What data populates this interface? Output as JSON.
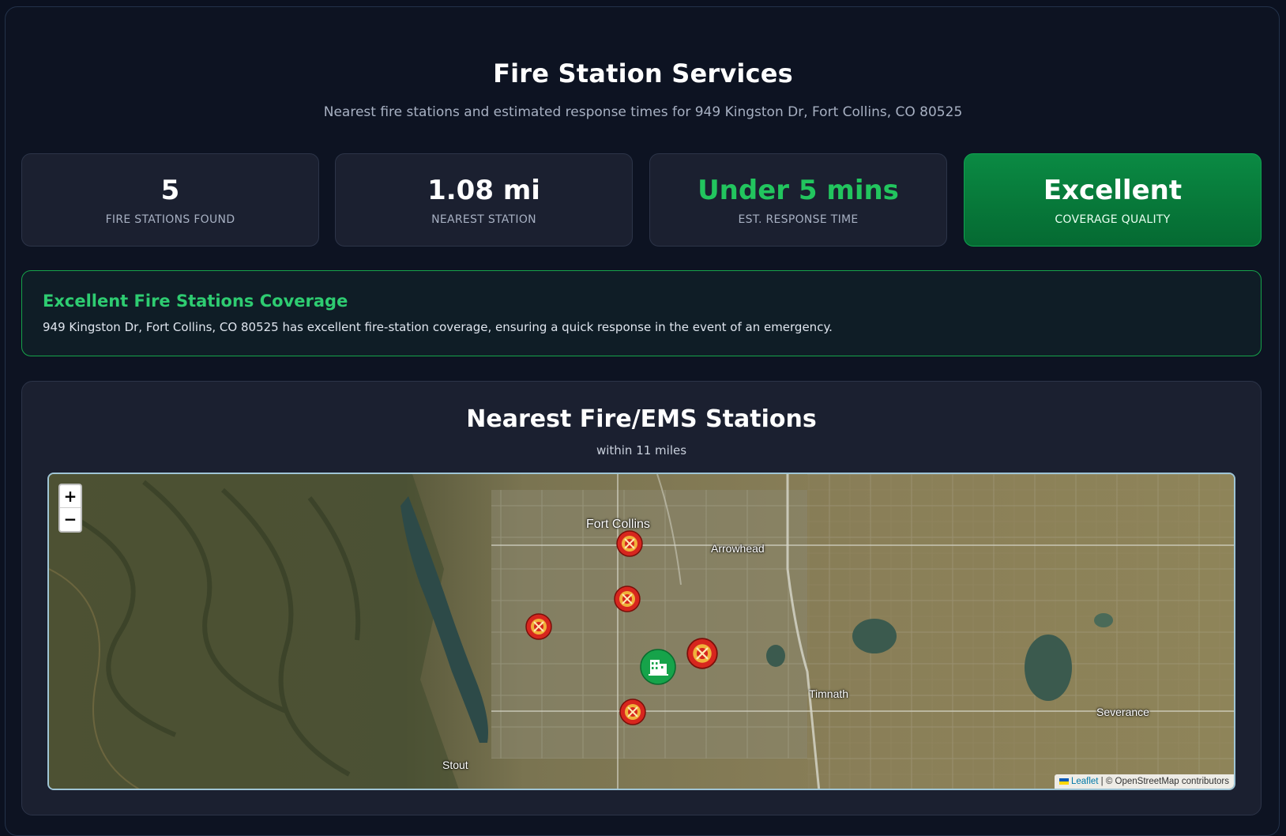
{
  "header": {
    "title": "Fire Station Services",
    "subtitle": "Nearest fire stations and estimated response times for 949 Kingston Dr, Fort Collins, CO 80525"
  },
  "stats": [
    {
      "value": "5",
      "label": "FIRE STATIONS FOUND"
    },
    {
      "value": "1.08 mi",
      "label": "NEAREST STATION"
    },
    {
      "value": "Under 5 mins",
      "label": "EST. RESPONSE TIME"
    },
    {
      "value": "Excellent",
      "label": "COVERAGE QUALITY"
    }
  ],
  "coverage": {
    "title": "Excellent Fire Stations Coverage",
    "text": "949 Kingston Dr, Fort Collins, CO 80525 has excellent fire-station coverage, ensuring a quick response in the event of an emergency."
  },
  "map": {
    "title": "Nearest Fire/EMS Stations",
    "subtitle": "within 11 miles",
    "zoom_in": "+",
    "zoom_out": "−",
    "places": {
      "fort_collins": "Fort Collins",
      "arrowhead": "Arrowhead",
      "timnath": "Timnath",
      "severance": "Severance",
      "stout": "Stout"
    },
    "attribution": {
      "leaflet": "Leaflet",
      "rest": "| © OpenStreetMap contributors"
    },
    "station_icon": "fire-station-icon",
    "home_icon": "building-icon"
  },
  "colors": {
    "accent_green": "#22c55e",
    "marker_red": "#d7261e",
    "marker_ring": "#f0b23a",
    "home_green": "#16a34a"
  }
}
